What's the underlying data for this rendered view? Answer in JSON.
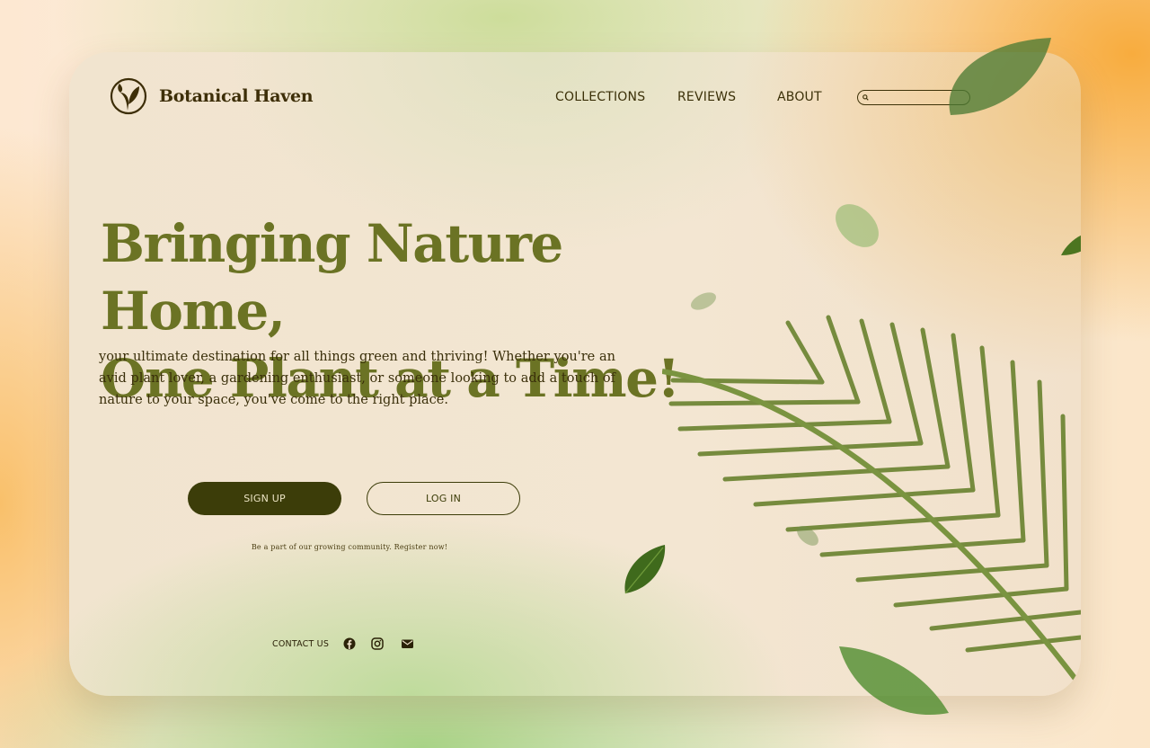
{
  "brand": {
    "name": "Botanical Haven",
    "logo_icon": "leaf-sprout-icon"
  },
  "nav": {
    "items": [
      "COLLECTIONS",
      "REVIEWS",
      "ABOUT"
    ]
  },
  "search": {
    "placeholder": "",
    "value": "",
    "icon": "search-icon"
  },
  "hero": {
    "title_line1": "Bringing Nature Home,",
    "title_line2": "One Plant at a Time!",
    "description": "your ultimate destination for all things green and thriving! Whether you're an avid plant lover, a gardening enthusiast, or someone looking to add a touch of nature to your space, you've come to the right place."
  },
  "actions": {
    "signup_label": "SIGN UP",
    "login_label": "LOG IN",
    "register_note": "Be a part of our growing community. Register now!"
  },
  "footer": {
    "contact_label": "CONTACT US",
    "social_icons": [
      "facebook-icon",
      "instagram-icon",
      "mail-icon"
    ]
  },
  "colors": {
    "headline": "#6b7324",
    "text_dark": "#3b3008",
    "button_primary": "#3c3d09",
    "accent_orange": "#f8ac3e",
    "accent_green": "#a9d487"
  }
}
